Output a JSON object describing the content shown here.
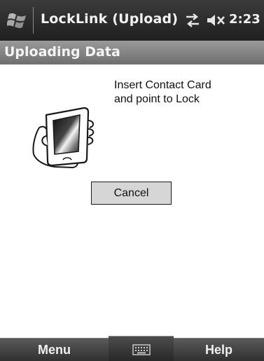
{
  "titlebar": {
    "start_icon": "windows-start-flag-icon",
    "app_title": "LockLink (Upload)",
    "connectivity_icon": "connectivity-arrows-icon",
    "volume_icon": "volume-muted-icon",
    "time": "2:23"
  },
  "header": {
    "title": "Uploading Data"
  },
  "content": {
    "instruction": "Insert Contact Card\nand point to Lock",
    "illustration_icon": "handheld-device-in-hand-icon",
    "cancel_label": "Cancel"
  },
  "softkeys": {
    "left_label": "Menu",
    "sip_icon": "keyboard-icon",
    "right_label": "Help"
  },
  "colors": {
    "titlebar": "#2a2a2a",
    "header": "#828282",
    "button": "#d6d6d6",
    "softkeybar": "#404040"
  }
}
